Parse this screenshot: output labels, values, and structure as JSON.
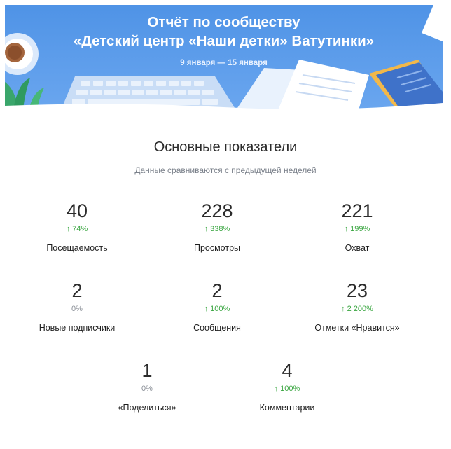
{
  "header": {
    "title_line1": "Отчёт по сообществу",
    "title_line2": "«Детский центр «Наши детки» Ватутинки»",
    "dates": "9 января — 15 января"
  },
  "section": {
    "title": "Основные показатели",
    "subtitle": "Данные сравниваются с предыдущей неделей"
  },
  "stats": [
    {
      "value": "40",
      "change": "74%",
      "trend": "up",
      "label": "Посещаемость"
    },
    {
      "value": "228",
      "change": "338%",
      "trend": "up",
      "label": "Просмотры"
    },
    {
      "value": "221",
      "change": "199%",
      "trend": "up",
      "label": "Охват"
    },
    {
      "value": "2",
      "change": "0%",
      "trend": "flat",
      "label": "Новые подписчики"
    },
    {
      "value": "2",
      "change": "100%",
      "trend": "up",
      "label": "Сообщения"
    },
    {
      "value": "23",
      "change": "2 200%",
      "trend": "up",
      "label": "Отметки «Нравится»"
    },
    {
      "value": "1",
      "change": "0%",
      "trend": "flat",
      "label": "«Поделиться»"
    },
    {
      "value": "4",
      "change": "100%",
      "trend": "up",
      "label": "Комментарии"
    }
  ],
  "icons": {
    "trend_up": "arrow-up-icon"
  },
  "colors": {
    "banner": "#4d8fe3",
    "positive": "#3aa641",
    "neutral": "#8a8f97"
  }
}
